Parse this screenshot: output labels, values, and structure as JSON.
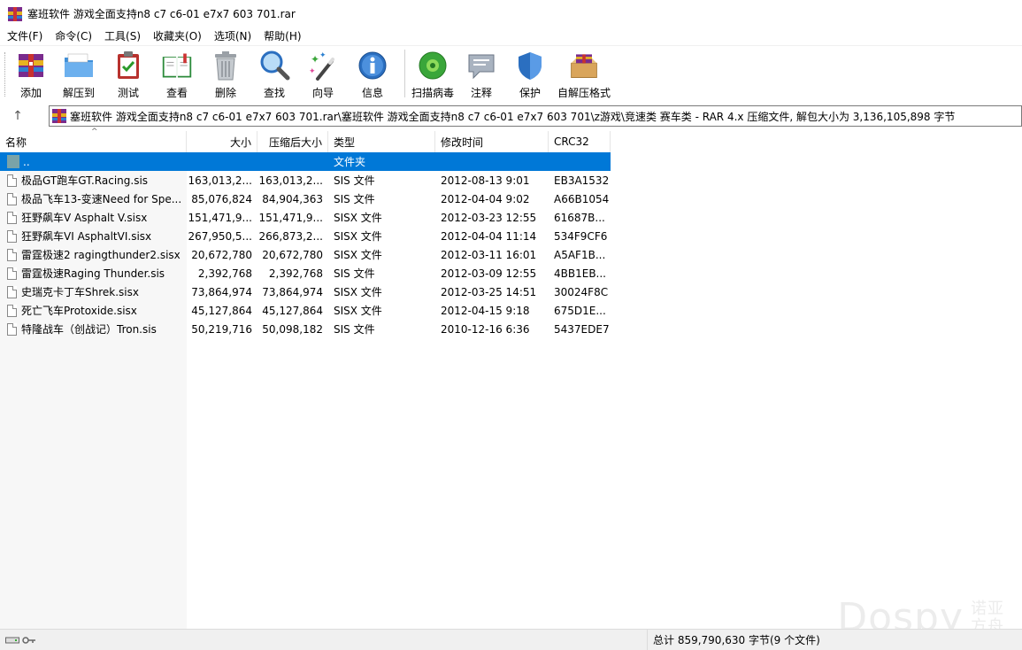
{
  "window": {
    "title": "塞班软件 游戏全面支持n8 c7 c6-01 e7x7 603 701.rar"
  },
  "menu": [
    {
      "label": "文件(F)"
    },
    {
      "label": "命令(C)"
    },
    {
      "label": "工具(S)"
    },
    {
      "label": "收藏夹(O)"
    },
    {
      "label": "选项(N)"
    },
    {
      "label": "帮助(H)"
    }
  ],
  "toolbar": {
    "buttons": [
      {
        "label": "添加",
        "icon": "add-archive-icon"
      },
      {
        "label": "解压到",
        "icon": "extract-folder-icon"
      },
      {
        "label": "测试",
        "icon": "test-clipboard-icon"
      },
      {
        "label": "查看",
        "icon": "view-book-icon"
      },
      {
        "label": "删除",
        "icon": "trash-icon"
      },
      {
        "label": "查找",
        "icon": "magnifier-icon"
      },
      {
        "label": "向导",
        "icon": "wizard-wand-icon"
      },
      {
        "label": "信息",
        "icon": "info-icon"
      },
      {
        "label": "扫描病毒",
        "icon": "virus-scan-icon"
      },
      {
        "label": "注释",
        "icon": "comment-icon"
      },
      {
        "label": "保护",
        "icon": "shield-icon"
      },
      {
        "label": "自解压格式",
        "icon": "sfx-box-icon"
      }
    ]
  },
  "address": {
    "up_glyph": "↑",
    "path": "塞班软件 游戏全面支持n8 c7 c6-01 e7x7 603 701.rar\\塞班软件 游戏全面支持n8 c7 c6-01 e7x7 603 701\\z游戏\\竞速类 赛车类 - RAR 4.x 压缩文件, 解包大小为 3,136,105,898 字节"
  },
  "columns": {
    "name": "名称",
    "size": "大小",
    "packed": "压缩后大小",
    "type": "类型",
    "modified": "修改时间",
    "crc": "CRC32",
    "sort_glyph": "^"
  },
  "parent_row": {
    "name": "..",
    "type": "文件夹"
  },
  "files": [
    {
      "name": "极品GT跑车GT.Racing.sis",
      "size": "163,013,2...",
      "packed": "163,013,2...",
      "type": "SIS 文件",
      "modified": "2012-08-13 9:01",
      "crc": "EB3A1532"
    },
    {
      "name": "极品飞车13-变速Need for Spe...",
      "size": "85,076,824",
      "packed": "84,904,363",
      "type": "SIS 文件",
      "modified": "2012-04-04 9:02",
      "crc": "A66B1054"
    },
    {
      "name": "狂野飙车V  Asphalt  V.sisx",
      "size": "151,471,9...",
      "packed": "151,471,9...",
      "type": "SISX 文件",
      "modified": "2012-03-23 12:55",
      "crc": "61687B..."
    },
    {
      "name": "狂野飙车VI AsphaltVI.sisx",
      "size": "267,950,5...",
      "packed": "266,873,2...",
      "type": "SISX 文件",
      "modified": "2012-04-04 11:14",
      "crc": "534F9CF6"
    },
    {
      "name": "雷霆极速2 ragingthunder2.sisx",
      "size": "20,672,780",
      "packed": "20,672,780",
      "type": "SISX 文件",
      "modified": "2012-03-11 16:01",
      "crc": "A5AF1B..."
    },
    {
      "name": "雷霆极速Raging Thunder.sis",
      "size": "2,392,768",
      "packed": "2,392,768",
      "type": "SIS 文件",
      "modified": "2012-03-09 12:55",
      "crc": "4BB1EB..."
    },
    {
      "name": "史瑞克卡丁车Shrek.sisx",
      "size": "73,864,974",
      "packed": "73,864,974",
      "type": "SISX 文件",
      "modified": "2012-03-25 14:51",
      "crc": "30024F8C"
    },
    {
      "name": "死亡飞车Protoxide.sisx",
      "size": "45,127,864",
      "packed": "45,127,864",
      "type": "SISX 文件",
      "modified": "2012-04-15 9:18",
      "crc": "675D1E..."
    },
    {
      "name": "特隆战车（创战记）Tron.sis",
      "size": "50,219,716",
      "packed": "50,098,182",
      "type": "SIS 文件",
      "modified": "2010-12-16 6:36",
      "crc": "5437EDE7"
    }
  ],
  "status": {
    "text": "总计 859,790,630 字节(9 个文件)"
  },
  "watermark": {
    "big": "Dospy",
    "small_1": "诺亚",
    "small_2": "方舟"
  }
}
